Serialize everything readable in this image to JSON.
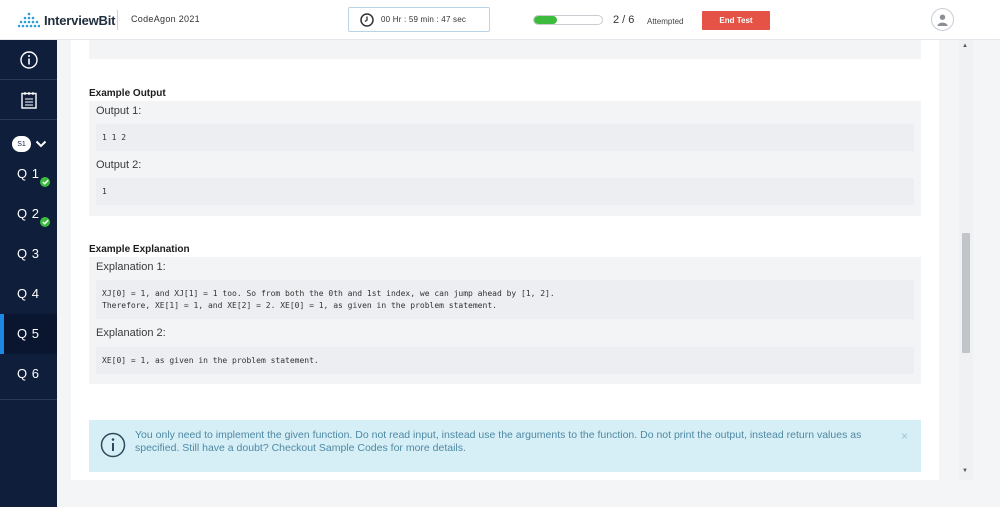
{
  "header": {
    "logo_text": "InterviewBit",
    "contest_name": "CodeAgon 2021",
    "timer": "00 Hr : 59 min : 47 sec",
    "progress_fraction": 0.333,
    "attempt_count": "2 / 6",
    "attempted_label": "Attempted",
    "end_test_label": "End Test",
    "icons": {
      "clock": "clock-icon",
      "avatar": "user-avatar-icon"
    },
    "colors": {
      "end_button": "#e55347",
      "progress": "#3dbb3f"
    }
  },
  "sidebar": {
    "icons": [
      "info-icon",
      "notepad-icon"
    ],
    "section_badge": "S1",
    "questions": [
      {
        "label": "Q 1",
        "solved": true
      },
      {
        "label": "Q 2",
        "solved": true
      },
      {
        "label": "Q 3",
        "solved": false
      },
      {
        "label": "Q 4",
        "solved": false
      },
      {
        "label": "Q 5",
        "solved": false,
        "active": true
      },
      {
        "label": "Q 6",
        "solved": false
      }
    ],
    "colors": {
      "background": "#0f1e3a",
      "active_marker": "#1e88e5"
    }
  },
  "content": {
    "example_output": {
      "title": "Example Output",
      "items": [
        {
          "label": "Output 1:",
          "code": "1 1 2"
        },
        {
          "label": "Output 2:",
          "code": "1"
        }
      ]
    },
    "example_explanation": {
      "title": "Example Explanation",
      "items": [
        {
          "label": "Explanation 1:",
          "code": "XJ[0] = 1, and XJ[1] = 1 too. So from both the 0th and 1st index, we can jump ahead by [1, 2].\nTherefore, XE[1] = 1, and XE[2] = 2. XE[0] = 1, as given in the problem statement."
        },
        {
          "label": "Explanation 2:",
          "code": "XE[0] = 1, as given in the problem statement."
        }
      ]
    },
    "note": {
      "text": "You only need to implement the given function. Do not read input, instead use the arguments to the function. Do not print the output, instead return values as specified. Still have a doubt? Checkout Sample Codes for more details.",
      "close": "×"
    }
  }
}
